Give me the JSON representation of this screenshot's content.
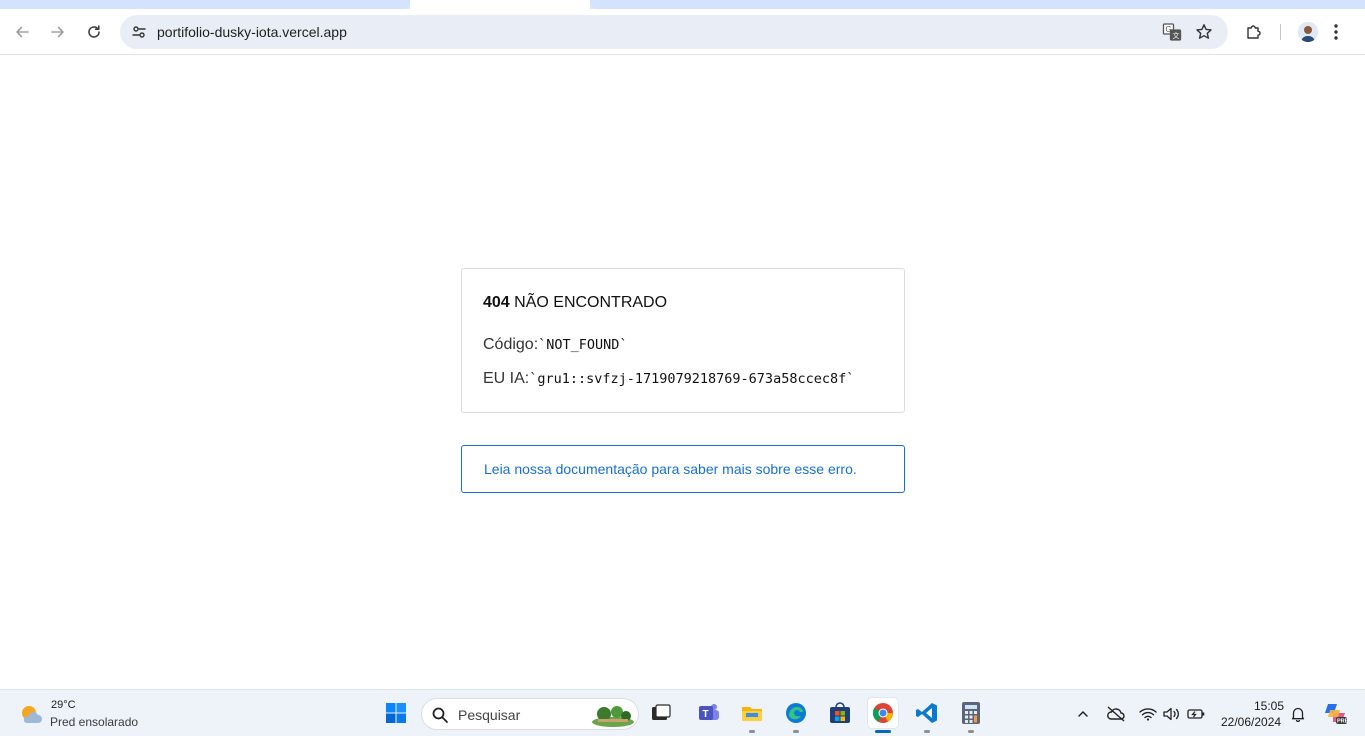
{
  "browser": {
    "url": "portifolio-dusky-iota.vercel.app"
  },
  "error_card": {
    "code_number": "404",
    "code_text": "NÃO ENCONTRADO",
    "code_label": "Código:",
    "code_value": "`NOT_FOUND`",
    "id_label": "EU IA:",
    "id_value": "`gru1::svfzj-1719079218769-673a58ccec8f`"
  },
  "doc_link": {
    "text": "Leia nossa documentação para saber mais sobre esse erro."
  },
  "taskbar": {
    "weather_temp": "29°C",
    "weather_desc": "Pred ensolarado",
    "search_placeholder": "Pesquisar",
    "clock_time": "15:05",
    "clock_date": "22/06/2024"
  },
  "colors": {
    "link": "#1a6fd1",
    "omnibox_bg": "#e9eef6",
    "taskbar_bg": "#eef2f9"
  }
}
